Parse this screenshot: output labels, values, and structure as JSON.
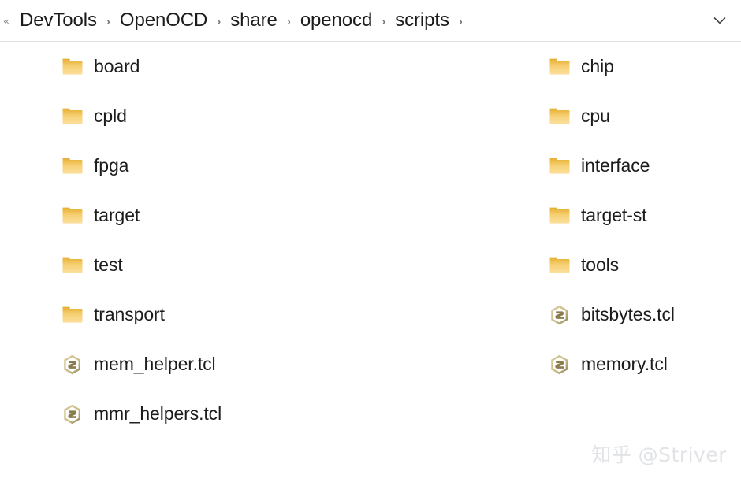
{
  "window": {
    "type": "file-explorer",
    "background_color": "#ffffff"
  },
  "address_bar": {
    "overflow_icon": "double-left-chevron-icon",
    "overflow_glyph": "«",
    "dropdown_icon": "chevron-down-icon",
    "separator_glyph": "›",
    "breadcrumbs": [
      {
        "label": "DevTools"
      },
      {
        "label": "OpenOCD"
      },
      {
        "label": "share"
      },
      {
        "label": "openocd"
      },
      {
        "label": "scripts"
      }
    ],
    "trailing_separator": true,
    "text_color": "#1b1b1b",
    "separator_color": "#777777",
    "border_color": "#e3e3e3"
  },
  "file_list": {
    "view": "list",
    "icon_names": {
      "folder": "folder-icon",
      "tcl": "tcl-script-file-icon"
    },
    "colors": {
      "folder_top": "#e9b53c",
      "folder_bottom": "#fbe09d",
      "tcl_light": "#cdbf8c",
      "tcl_dark": "#8a7c4e",
      "label": "#1c1c1c"
    },
    "columns": [
      {
        "name": "left-column",
        "items": [
          {
            "name": "board",
            "type": "folder"
          },
          {
            "name": "cpld",
            "type": "folder"
          },
          {
            "name": "fpga",
            "type": "folder"
          },
          {
            "name": "target",
            "type": "folder"
          },
          {
            "name": "test",
            "type": "folder"
          },
          {
            "name": "transport",
            "type": "folder"
          },
          {
            "name": "mem_helper.tcl",
            "type": "tcl"
          },
          {
            "name": "mmr_helpers.tcl",
            "type": "tcl"
          }
        ]
      },
      {
        "name": "right-column",
        "items": [
          {
            "name": "chip",
            "type": "folder"
          },
          {
            "name": "cpu",
            "type": "folder"
          },
          {
            "name": "interface",
            "type": "folder"
          },
          {
            "name": "target-st",
            "type": "folder"
          },
          {
            "name": "tools",
            "type": "folder"
          },
          {
            "name": "bitsbytes.tcl",
            "type": "tcl"
          },
          {
            "name": "memory.tcl",
            "type": "tcl"
          }
        ]
      }
    ]
  },
  "watermark": {
    "text": "知乎 @Striver",
    "color": "#e1e3e6"
  }
}
